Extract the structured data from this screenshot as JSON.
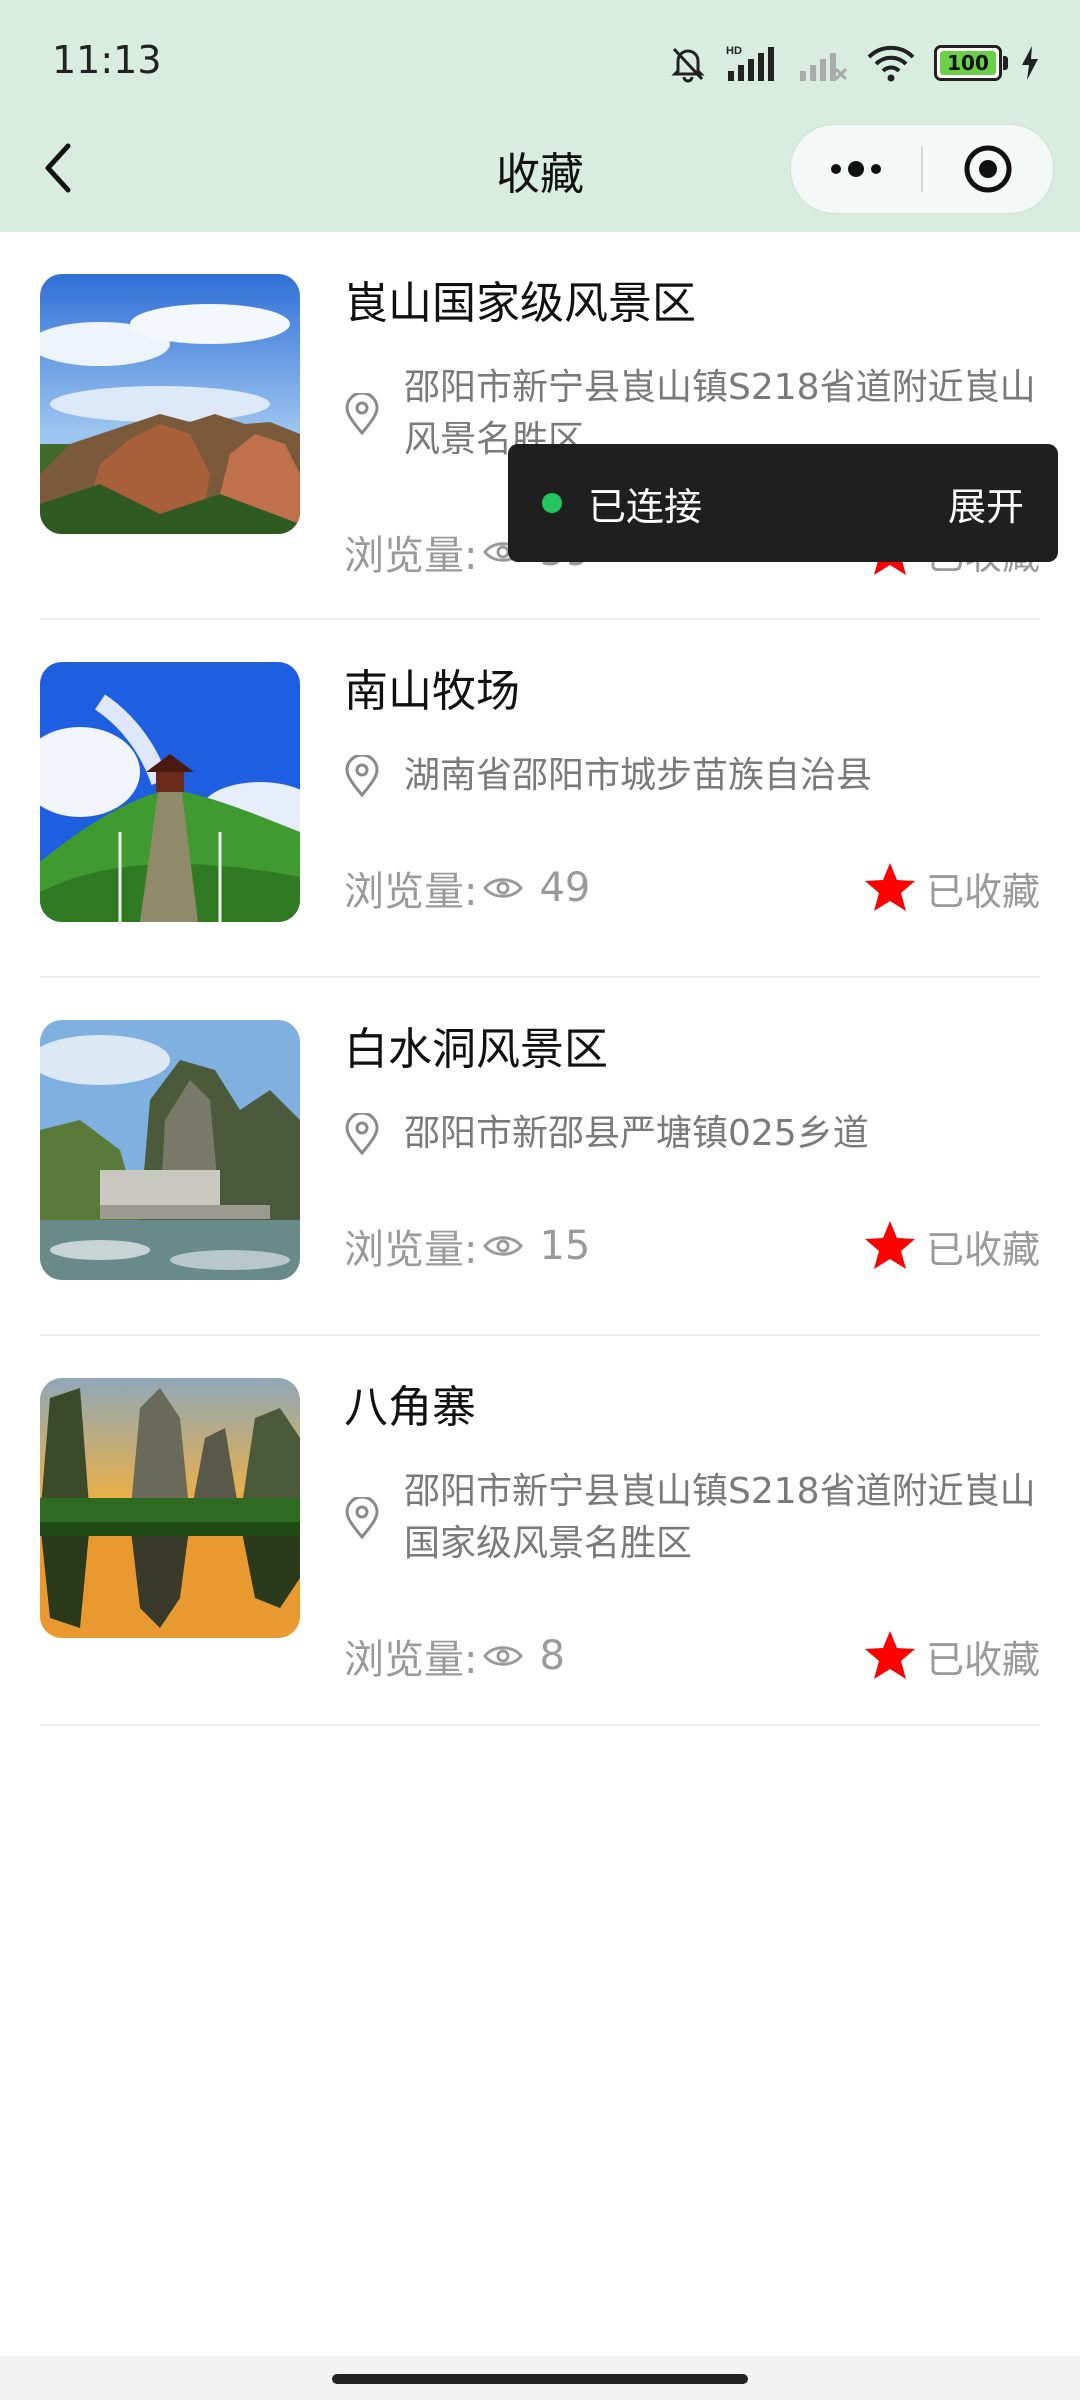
{
  "status_bar": {
    "time": "11:13",
    "battery": "100",
    "network": "HD"
  },
  "header": {
    "title": "收藏"
  },
  "toast": {
    "text": "已连接",
    "action": "展开"
  },
  "list": {
    "views_label": "浏览量:",
    "fav_label": "已收藏",
    "items": [
      {
        "title": "崀山国家级风景区",
        "address": "邵阳市新宁县崀山镇S218省道附近崀山风景名胜区",
        "views": "59",
        "image": "mountain-landscape"
      },
      {
        "title": "南山牧场",
        "address": "湖南省邵阳市城步苗族自治县",
        "views": "49",
        "image": "pavilion-meadow"
      },
      {
        "title": "白水洞风景区",
        "address": "邵阳市新邵县严塘镇025乡道",
        "views": "15",
        "image": "cliff-river"
      },
      {
        "title": "八角寨",
        "address": "邵阳市新宁县崀山镇S218省道附近崀山国家级风景名胜区",
        "views": "8",
        "image": "sunset-reflection"
      }
    ]
  },
  "colors": {
    "header_bg": "#d8ece0",
    "star": "#ff0000",
    "toast_bg": "#1f1f1f",
    "connected_dot": "#22c55e"
  }
}
